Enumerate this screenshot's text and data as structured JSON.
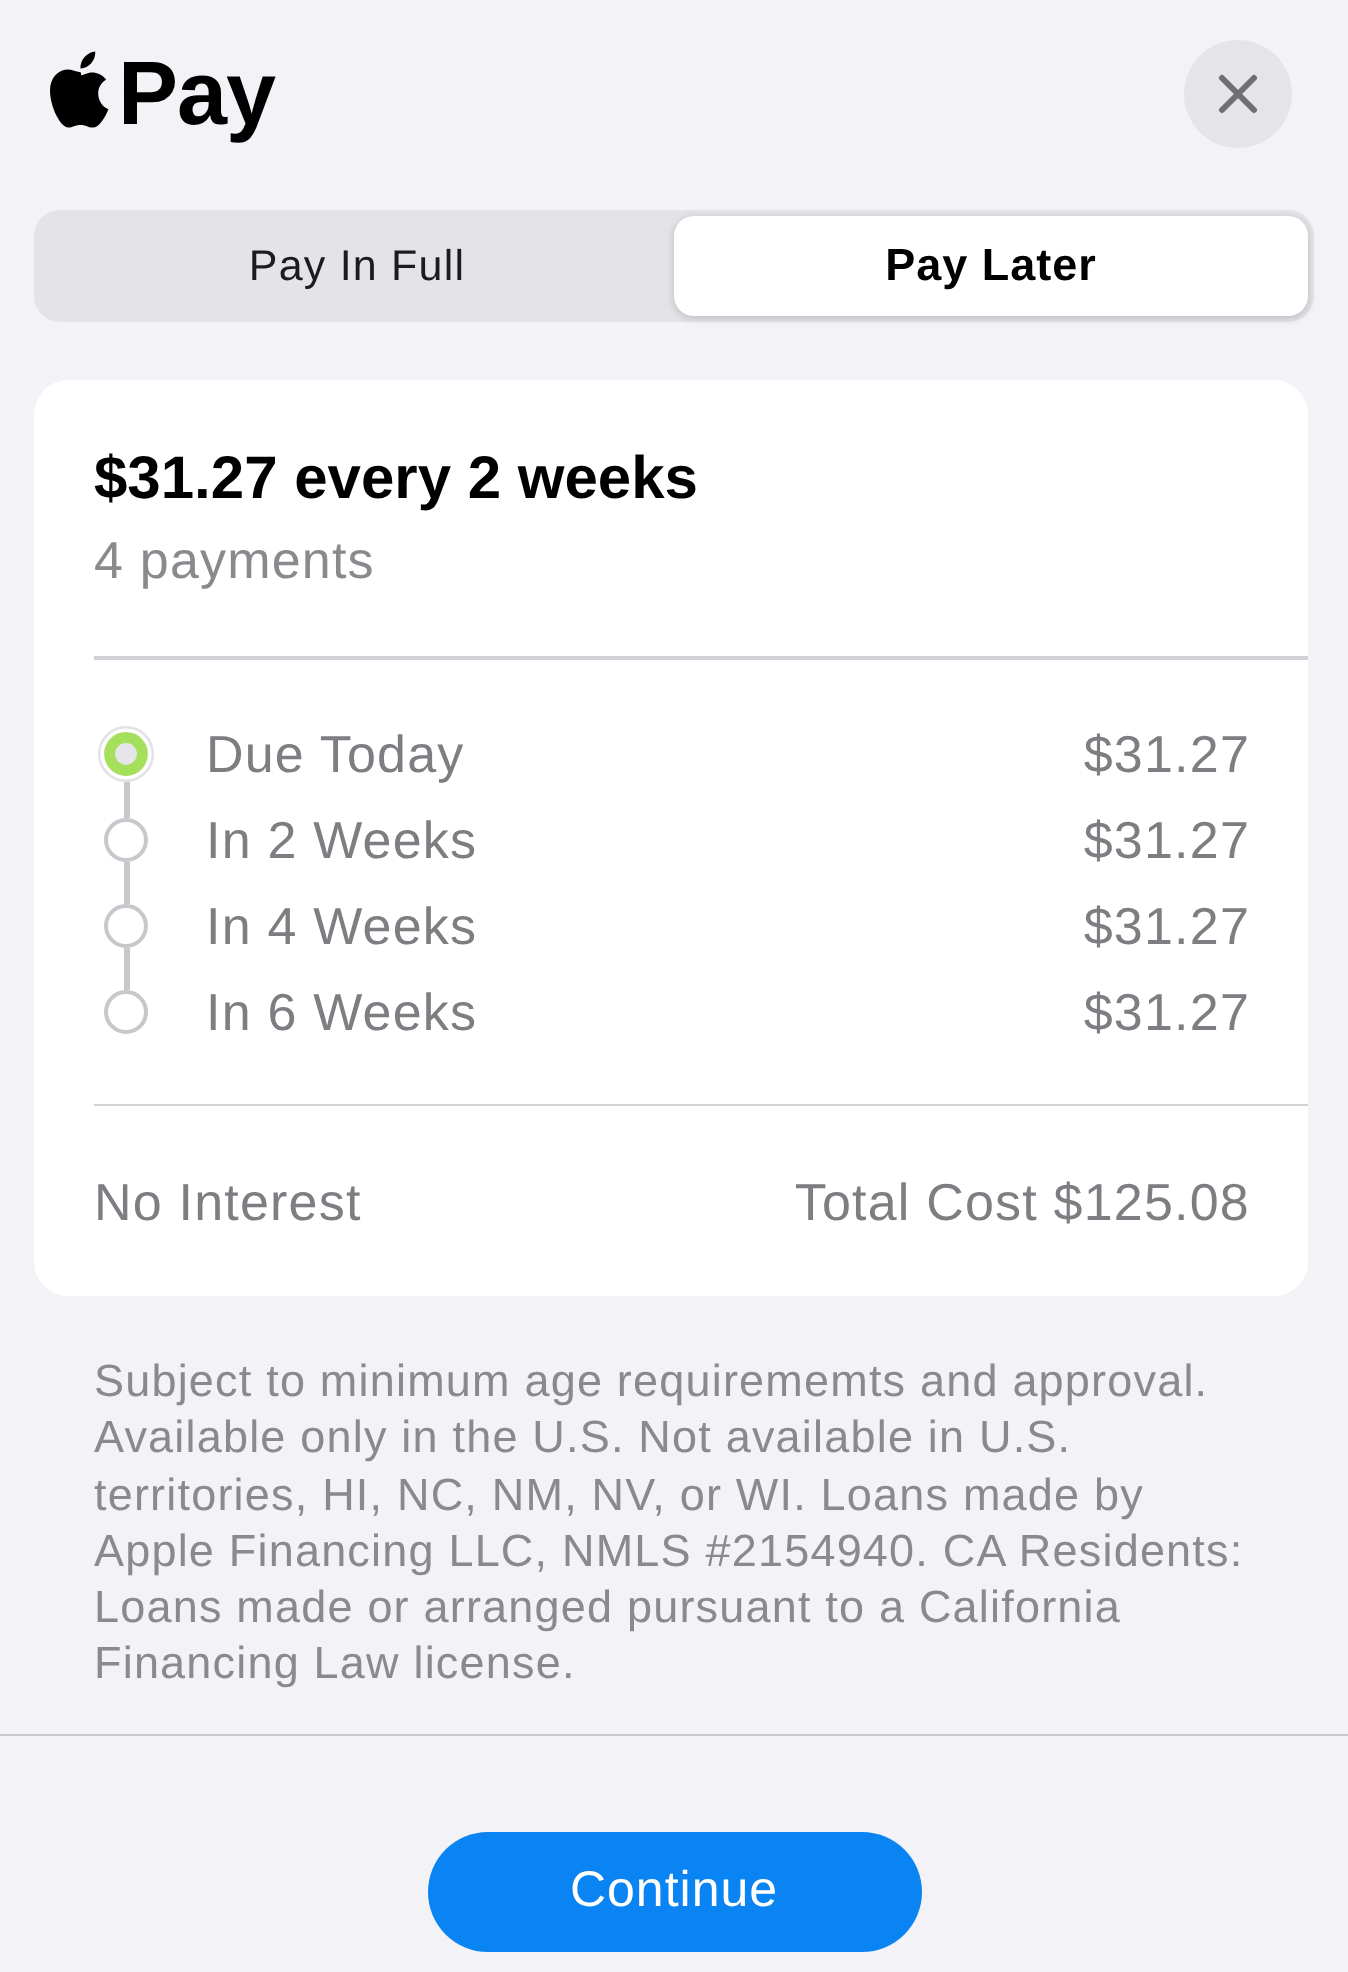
{
  "header": {
    "logo_text": "Pay"
  },
  "tabs": [
    {
      "label": "Pay In Full",
      "selected": false
    },
    {
      "label": "Pay Later",
      "selected": true
    }
  ],
  "plan": {
    "title": "$31.27 every 2 weeks",
    "subtitle": "4 payments",
    "schedule": [
      {
        "label": "Due Today",
        "amount": "$31.27",
        "current": true
      },
      {
        "label": "In 2 Weeks",
        "amount": "$31.27",
        "current": false
      },
      {
        "label": "In 4 Weeks",
        "amount": "$31.27",
        "current": false
      },
      {
        "label": "In 6 Weeks",
        "amount": "$31.27",
        "current": false
      }
    ],
    "interest": "No Interest",
    "total": "Total Cost $125.08"
  },
  "disclaimer": "Subject to minimum age requirememts and approval. Available only in the U.S. Not available in U.S. territories, HI, NC, NM, NV, or WI. Loans made by Apple Financing LLC, NMLS #2154940. CA Residents: Loans made or arranged pursuant to a California Financing Law license.",
  "continue_button": "Continue"
}
